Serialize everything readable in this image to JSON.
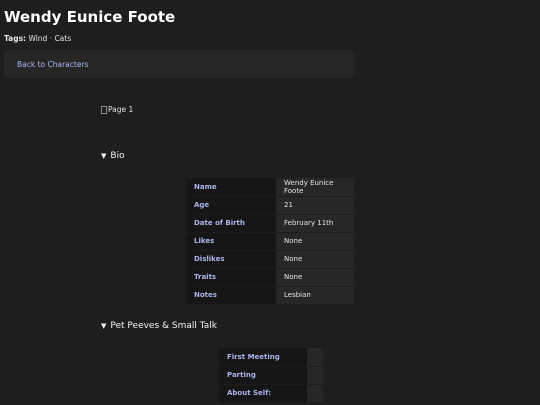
{
  "page": {
    "title": "Wendy Eunice Foote"
  },
  "tags": {
    "label": "Tags:",
    "value": "Wind · Cats"
  },
  "back_link": "Back to Characters",
  "image_alt": "Page 1",
  "sections": {
    "bio": {
      "title": "Bio",
      "rows": [
        {
          "key": "Name",
          "value": "Wendy Eunice Foote"
        },
        {
          "key": "Age",
          "value": "21"
        },
        {
          "key": "Date of Birth",
          "value": "February 11th"
        },
        {
          "key": "Likes",
          "value": "None"
        },
        {
          "key": "Dislikes",
          "value": "None"
        },
        {
          "key": "Traits",
          "value": "None"
        },
        {
          "key": "Notes",
          "value": "Lesbian"
        }
      ]
    },
    "pet_peeves": {
      "title": "Pet Peeves & Small Talk",
      "rows": [
        {
          "key": "First Meeting",
          "value": ""
        },
        {
          "key": "Parting",
          "value": ""
        },
        {
          "key": "About Self:",
          "value": ""
        }
      ]
    }
  },
  "icons": {
    "disclosure": "triangle-down-icon",
    "broken_image": "broken-image-icon"
  },
  "colors": {
    "background": "#1e1e1e",
    "link": "#aab6f2",
    "key_text": "#a9b4ec"
  }
}
